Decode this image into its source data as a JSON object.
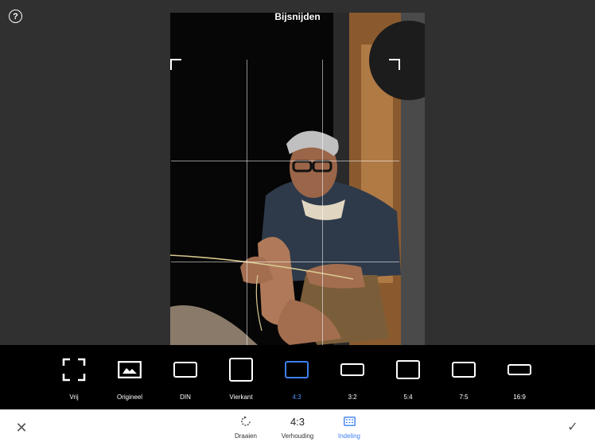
{
  "header": {
    "title": "Bijsnijden",
    "help_symbol": "?"
  },
  "ratios": [
    {
      "label": "Vrij",
      "icon": "free-crop-icon"
    },
    {
      "label": "Origineel",
      "icon": "image-icon"
    },
    {
      "label": "DIN",
      "icon": "din-ratio-icon"
    },
    {
      "label": "Vierkant",
      "icon": "square-ratio-icon"
    },
    {
      "label": "4:3",
      "icon": "ratio-4-3-icon",
      "active": true
    },
    {
      "label": "3:2",
      "icon": "ratio-3-2-icon"
    },
    {
      "label": "5:4",
      "icon": "ratio-5-4-icon"
    },
    {
      "label": "7:5",
      "icon": "ratio-7-5-icon"
    },
    {
      "label": "16:9",
      "icon": "ratio-16-9-icon"
    }
  ],
  "toolbar": {
    "close_symbol": "✕",
    "confirm_symbol": "✓",
    "rotate_label": "Draaien",
    "ratio_value": "4:3",
    "ratio_label": "Verhouding",
    "layout_label": "Indeling"
  },
  "colors": {
    "accent": "#3d7ff0",
    "background": "#303030",
    "ratio_bar": "#000000"
  }
}
